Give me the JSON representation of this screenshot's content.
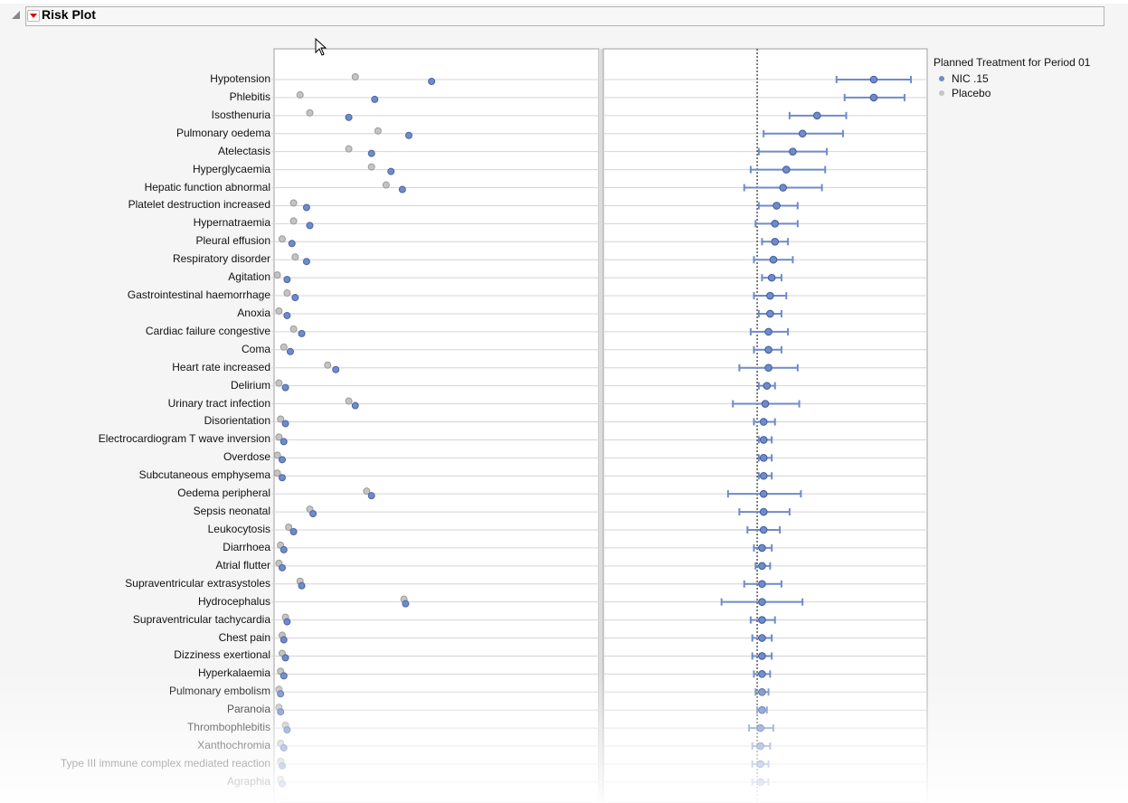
{
  "header": {
    "title": "Risk Plot"
  },
  "legend": {
    "title": "Planned Treatment for Period 01",
    "items": [
      {
        "label": "NIC .15",
        "color": "#6f8bc8"
      },
      {
        "label": "Placebo",
        "color": "#c4c4c4"
      }
    ]
  },
  "chart_data": [
    {
      "type": "scatter",
      "title": "Risk by treatment (dot plot)",
      "xlim": [
        0,
        100
      ],
      "note": "no axis tick labels shown; values in relative units",
      "categories": [
        "Hypotension",
        "Phlebitis",
        "Isosthenuria",
        "Pulmonary oedema",
        "Atelectasis",
        "Hyperglycaemia",
        "Hepatic function abnormal",
        "Platelet destruction increased",
        "Hypernatraemia",
        "Pleural effusion",
        "Respiratory disorder",
        "Agitation",
        "Gastrointestinal haemorrhage",
        "Anoxia",
        "Cardiac failure congestive",
        "Coma",
        "Heart rate increased",
        "Delirium",
        "Urinary tract infection",
        "Disorientation",
        "Electrocardiogram T wave inversion",
        "Overdose",
        "Subcutaneous emphysema",
        "Oedema peripheral",
        "Sepsis neonatal",
        "Leukocytosis",
        "Diarrhoea",
        "Atrial flutter",
        "Supraventricular extrasystoles",
        "Hydrocephalus",
        "Supraventricular tachycardia",
        "Chest pain",
        "Dizziness exertional",
        "Hyperkalaemia",
        "Pulmonary embolism",
        "Paranoia",
        "Thrombophlebitis",
        "Xanthochromia",
        "Type III immune complex mediated reaction",
        "Agraphia"
      ],
      "series": [
        {
          "name": "NIC .15",
          "values": [
            48.5,
            31,
            23,
            41.5,
            30,
            36,
            39.5,
            10,
            11,
            5.5,
            10,
            4,
            6.5,
            4,
            8.5,
            5,
            19,
            3.5,
            25,
            3.5,
            3,
            2.5,
            2.5,
            30,
            12,
            6,
            3,
            2.5,
            8.5,
            40.5,
            4,
            3,
            3.5,
            3,
            2,
            2,
            4,
            3,
            2.5,
            2.5
          ]
        },
        {
          "name": "Placebo",
          "values": [
            25,
            8,
            11,
            32,
            23,
            30,
            34.5,
            6,
            6,
            2.5,
            6.5,
            1,
            4,
            1.5,
            6,
            3,
            16.5,
            1.5,
            23,
            2,
            1.5,
            1,
            1,
            28.5,
            11,
            4.5,
            2,
            1.5,
            8,
            40,
            3.5,
            2.5,
            2.5,
            2,
            1.5,
            1.5,
            3.5,
            2,
            2,
            2
          ]
        }
      ]
    },
    {
      "type": "scatter",
      "title": "Risk difference with confidence interval",
      "xlim": [
        -0.95,
        1.05
      ],
      "reference_line": 0,
      "estimate": [
        0.72,
        0.72,
        0.37,
        0.28,
        0.22,
        0.18,
        0.16,
        0.12,
        0.11,
        0.11,
        0.1,
        0.09,
        0.08,
        0.08,
        0.07,
        0.07,
        0.07,
        0.06,
        0.05,
        0.04,
        0.04,
        0.04,
        0.04,
        0.04,
        0.04,
        0.04,
        0.03,
        0.03,
        0.03,
        0.03,
        0.03,
        0.03,
        0.03,
        0.03,
        0.03,
        0.03,
        0.02,
        0.02,
        0.02,
        0.02
      ],
      "lower": [
        0.49,
        0.54,
        0.2,
        0.04,
        0.01,
        -0.04,
        -0.08,
        0.01,
        -0.01,
        0.03,
        -0.02,
        0.03,
        -0.02,
        0.01,
        -0.04,
        -0.02,
        -0.11,
        0.01,
        -0.15,
        -0.02,
        0.01,
        0.01,
        0.01,
        -0.18,
        -0.11,
        -0.06,
        -0.02,
        -0.01,
        -0.08,
        -0.22,
        -0.04,
        -0.03,
        -0.03,
        -0.02,
        -0.01,
        0.0,
        -0.05,
        -0.03,
        -0.03,
        -0.03
      ],
      "upper": [
        0.95,
        0.91,
        0.55,
        0.53,
        0.43,
        0.42,
        0.4,
        0.25,
        0.25,
        0.19,
        0.22,
        0.15,
        0.18,
        0.15,
        0.19,
        0.15,
        0.25,
        0.11,
        0.26,
        0.11,
        0.09,
        0.09,
        0.09,
        0.27,
        0.2,
        0.14,
        0.09,
        0.08,
        0.15,
        0.28,
        0.11,
        0.09,
        0.09,
        0.08,
        0.07,
        0.06,
        0.1,
        0.08,
        0.07,
        0.07
      ]
    }
  ]
}
